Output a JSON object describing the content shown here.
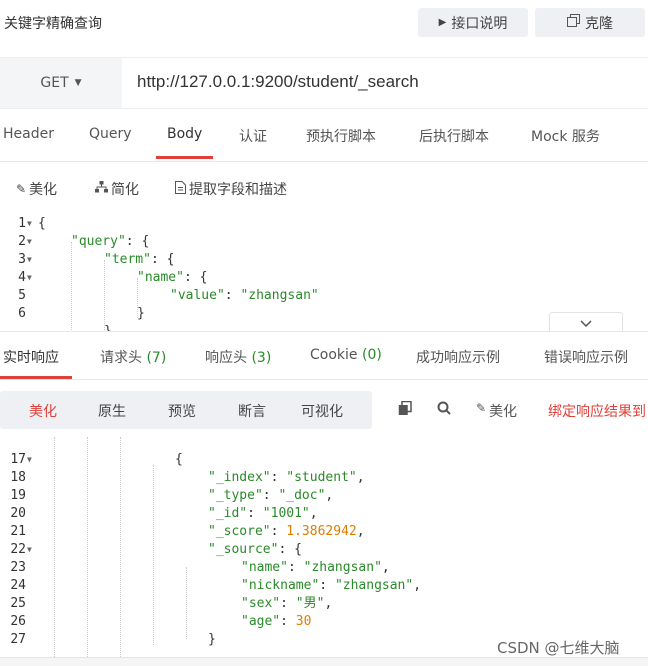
{
  "header": {
    "title": "关键字精确查询",
    "doc_button": "接口说明",
    "clone_button": "克隆"
  },
  "request": {
    "method": "GET",
    "url": "http://127.0.0.1:9200/student/_search",
    "tabs": [
      "Header",
      "Query",
      "Body",
      "认证",
      "预执行脚本",
      "后执行脚本",
      "Mock 服务"
    ],
    "active_tab": "Body",
    "body_tools": [
      "美化",
      "简化",
      "提取字段和描述"
    ]
  },
  "request_body_lines": [
    {
      "n": "1",
      "fold": true,
      "indent": 0,
      "text": "{"
    },
    {
      "n": "2",
      "fold": true,
      "indent": 1,
      "key": "\"query\"",
      "rest": ": {"
    },
    {
      "n": "3",
      "fold": true,
      "indent": 2,
      "key": "\"term\"",
      "rest": ": {"
    },
    {
      "n": "4",
      "fold": true,
      "indent": 3,
      "key": "\"name\"",
      "rest": ": {"
    },
    {
      "n": "5",
      "fold": false,
      "indent": 4,
      "key": "\"value\"",
      "rest": ": ",
      "str": "\"zhangsan\""
    },
    {
      "n": "6",
      "fold": false,
      "indent": 3,
      "text": "}"
    },
    {
      "n": "",
      "fold": false,
      "indent": 2,
      "text": "}"
    }
  ],
  "response": {
    "tabs": [
      {
        "label": "实时响应",
        "count": ""
      },
      {
        "label": "请求头",
        "count": "(7)"
      },
      {
        "label": "响应头",
        "count": "(3)"
      },
      {
        "label": "Cookie",
        "count": "(0)"
      },
      {
        "label": "成功响应示例",
        "count": ""
      },
      {
        "label": "错误响应示例",
        "count": ""
      }
    ],
    "view_modes": [
      "美化",
      "原生",
      "预览",
      "断言",
      "可视化"
    ],
    "beautify_label": "美化",
    "bind_label": "绑定响应结果到"
  },
  "response_body_lines": [
    {
      "n": "17",
      "fold": true,
      "indent": 4,
      "text": "{"
    },
    {
      "n": "18",
      "fold": false,
      "indent": 5,
      "key": "\"_index\"",
      "rest": ": ",
      "str": "\"student\"",
      "tail": ","
    },
    {
      "n": "19",
      "fold": false,
      "indent": 5,
      "key": "\"_type\"",
      "rest": ": ",
      "str": "\"_doc\"",
      "tail": ","
    },
    {
      "n": "20",
      "fold": false,
      "indent": 5,
      "key": "\"_id\"",
      "rest": ": ",
      "str": "\"1001\"",
      "tail": ","
    },
    {
      "n": "21",
      "fold": false,
      "indent": 5,
      "key": "\"_score\"",
      "rest": ": ",
      "num": "1.3862942",
      "tail": ","
    },
    {
      "n": "22",
      "fold": true,
      "indent": 5,
      "key": "\"_source\"",
      "rest": ": {"
    },
    {
      "n": "23",
      "fold": false,
      "indent": 6,
      "key": "\"name\"",
      "rest": ": ",
      "str": "\"zhangsan\"",
      "tail": ","
    },
    {
      "n": "24",
      "fold": false,
      "indent": 6,
      "key": "\"nickname\"",
      "rest": ": ",
      "str": "\"zhangsan\"",
      "tail": ","
    },
    {
      "n": "25",
      "fold": false,
      "indent": 6,
      "key": "\"sex\"",
      "rest": ": ",
      "str": "\"男\"",
      "tail": ","
    },
    {
      "n": "26",
      "fold": false,
      "indent": 6,
      "key": "\"age\"",
      "rest": ": ",
      "num": "30"
    },
    {
      "n": "27",
      "fold": false,
      "indent": 5,
      "text": "}"
    }
  ],
  "watermark": "CSDN @七维大脑"
}
